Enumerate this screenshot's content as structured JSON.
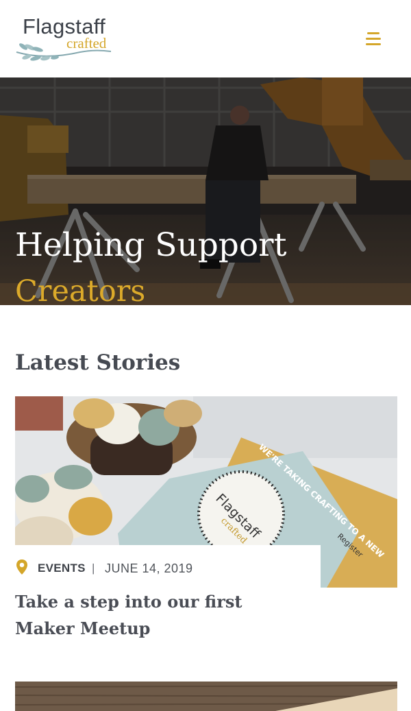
{
  "brand": {
    "name": "Flagstaff",
    "tagline": "crafted",
    "accent_color": "#d4a62a"
  },
  "header": {
    "menu_icon": "hamburger-icon"
  },
  "hero": {
    "title": "Helping Support",
    "subtitle": "Creators"
  },
  "stories": {
    "heading": "Latest Stories",
    "items": [
      {
        "category": "EVENTS",
        "separator": "|",
        "date": "JUNE 14, 2019",
        "title": "Take a step into our first Maker Meetup",
        "category_icon": "location-pin-icon"
      }
    ]
  },
  "flyer": {
    "banner": "WE'RE TAKING CRAFTING TO A NEW",
    "brand": "Flagstaff",
    "brand_sub": "crafted",
    "register": "Register"
  }
}
